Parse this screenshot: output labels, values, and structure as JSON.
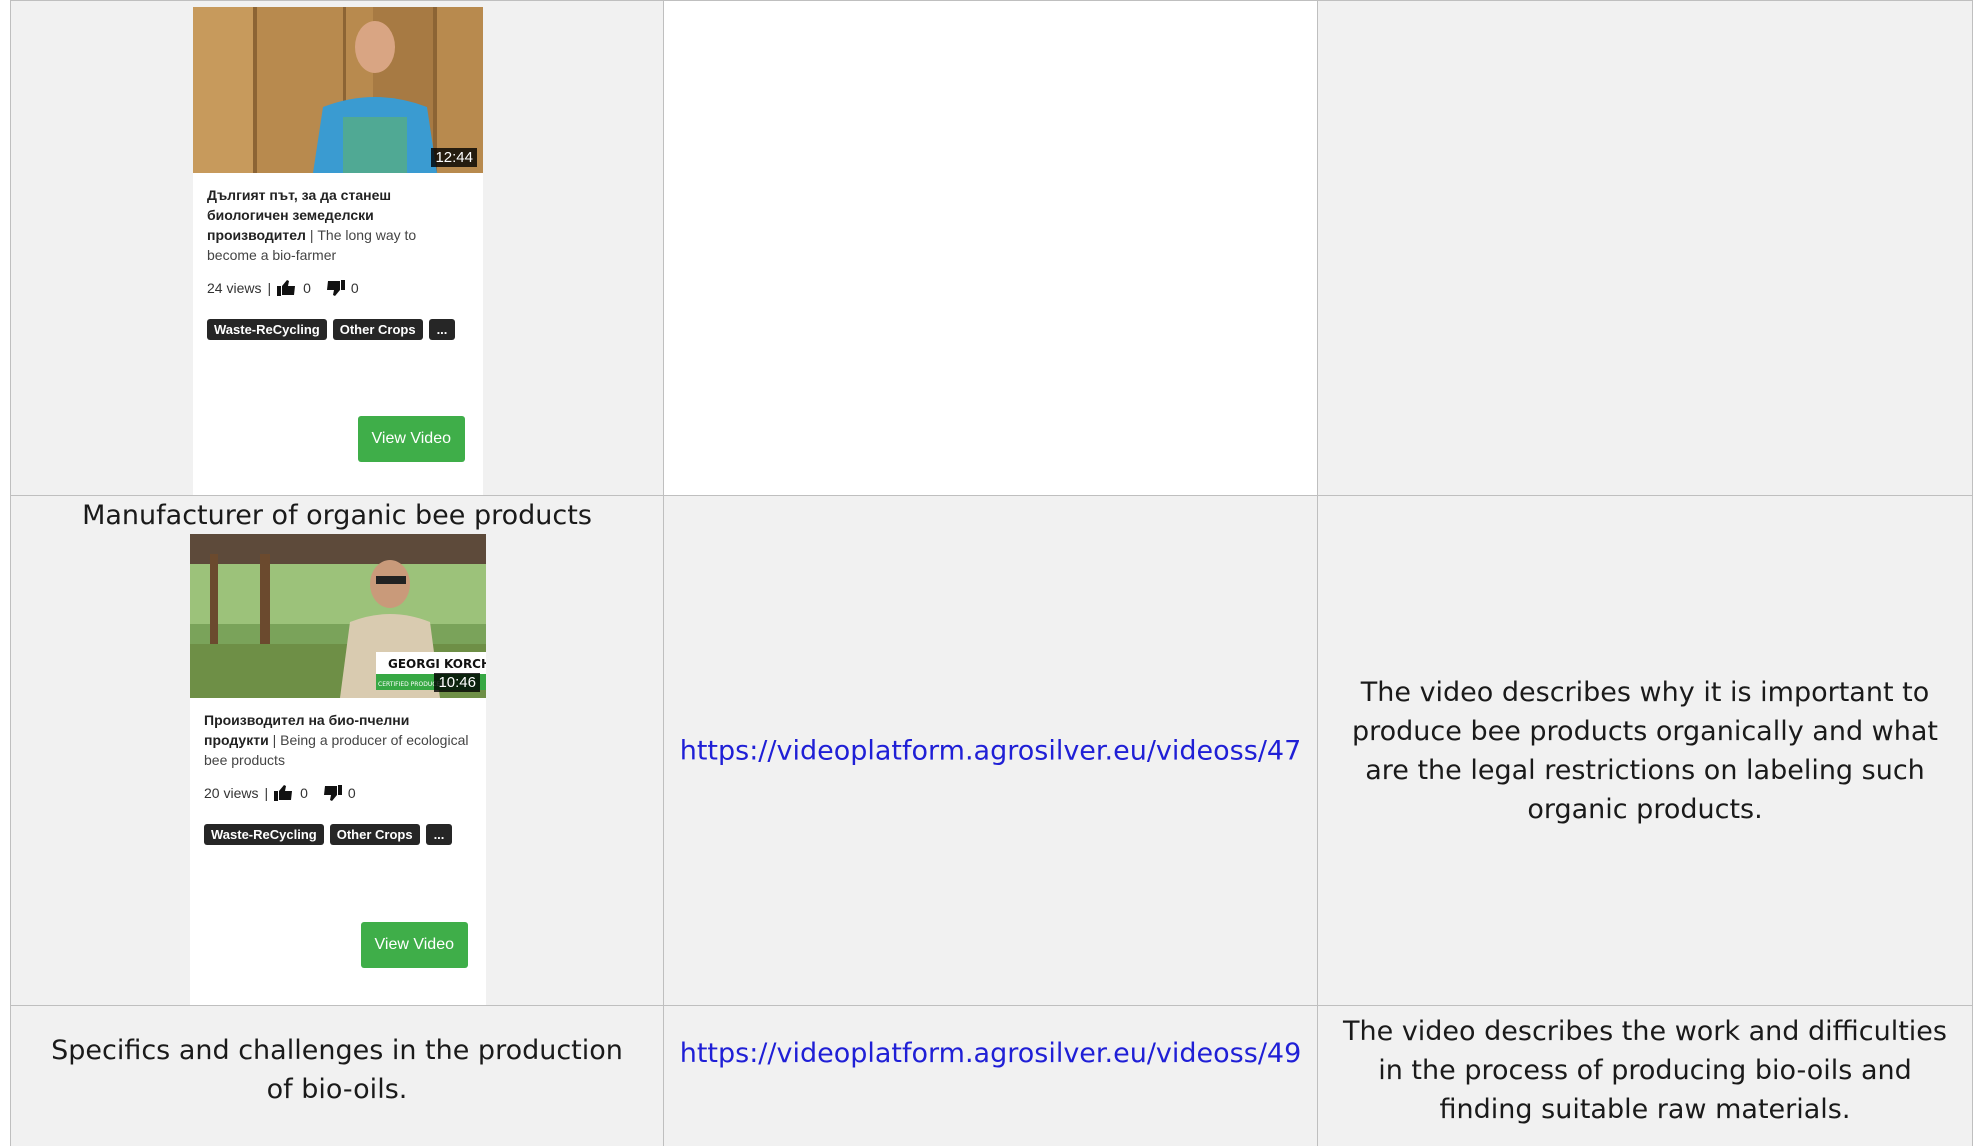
{
  "rows": [
    {
      "card": {
        "duration": "12:44",
        "title_bg": "Дългият път, за да станеш биологичен земеделски производител",
        "title_en": "The long way to become a bio-farmer",
        "views": "24 views",
        "likes": "0",
        "dislikes": "0",
        "tags": [
          "Waste-ReCycling",
          "Other Crops",
          "..."
        ],
        "button": "View Video"
      }
    },
    {
      "title": "Manufacturer of organic bee products",
      "card": {
        "duration": "10:46",
        "overlay_name": "GEORGI KORCHEV",
        "overlay_sub": "CERTIFIED PRODUCER OF",
        "title_bg": "Производител на био-пчелни продукти",
        "title_en": "Being a producer of ecological bee products",
        "views": "20 views",
        "likes": "0",
        "dislikes": "0",
        "tags": [
          "Waste-ReCycling",
          "Other Crops",
          "..."
        ],
        "button": "View Video"
      },
      "link": "https://videoplatform.agrosilver.eu/videoss/47",
      "description": "The video describes why it is important to produce bee products organically and what are the legal restrictions on labeling such organic products."
    },
    {
      "title": "Specifics and challenges in the production of bio-oils.",
      "link": "https://videoplatform.agrosilver.eu/videoss/49",
      "description": "The video describes the work and difficulties in the process of producing bio-oils and finding suitable raw materials."
    }
  ],
  "colors": {
    "button": "#3fae49",
    "link": "#1f1fd6",
    "tag": "#262626",
    "cell_gray": "#f1f1f1"
  }
}
